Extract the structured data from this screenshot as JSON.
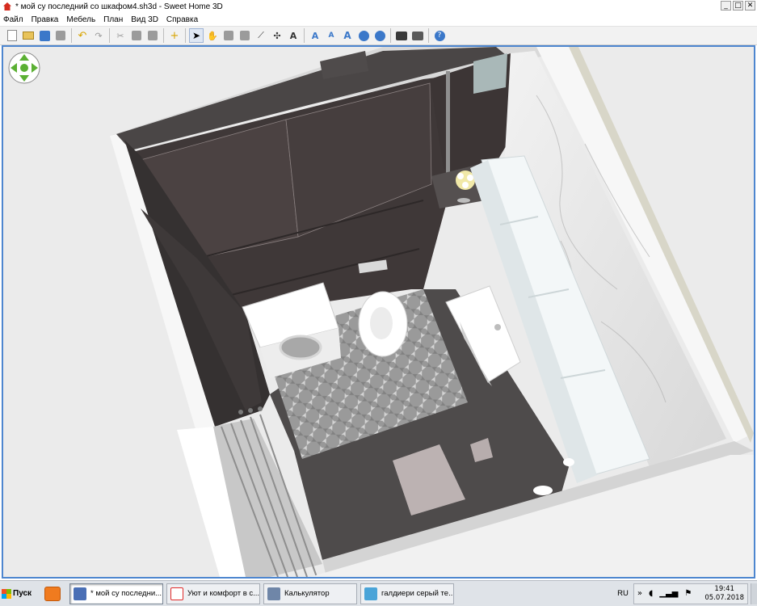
{
  "window": {
    "title": "* мой су последний со шкафом4.sh3d - Sweet Home 3D",
    "buttons": {
      "minimize": "_",
      "maximize": "□",
      "close": "✕"
    }
  },
  "menu": {
    "items": [
      "Файл",
      "Правка",
      "Мебель",
      "План",
      "Вид 3D",
      "Справка"
    ]
  },
  "toolbar": {
    "buttons": [
      {
        "name": "new-home",
        "icon": "document-icon"
      },
      {
        "name": "open",
        "icon": "folder-icon"
      },
      {
        "name": "save",
        "icon": "save-icon"
      },
      {
        "name": "preferences",
        "icon": "tools-icon"
      },
      {
        "name": "undo",
        "icon": "undo-icon"
      },
      {
        "name": "redo",
        "icon": "redo-icon"
      },
      {
        "name": "cut",
        "icon": "cut-icon"
      },
      {
        "name": "copy",
        "icon": "copy-icon"
      },
      {
        "name": "paste",
        "icon": "paste-icon"
      },
      {
        "name": "add-furniture",
        "icon": "add-furniture-icon"
      },
      {
        "name": "select-mode",
        "icon": "pointer-icon"
      },
      {
        "name": "pan-mode",
        "icon": "hand-icon"
      },
      {
        "name": "create-walls",
        "icon": "walls-icon"
      },
      {
        "name": "create-rooms",
        "icon": "rooms-icon"
      },
      {
        "name": "create-polylines",
        "icon": "polyline-icon"
      },
      {
        "name": "create-dimensions",
        "icon": "dimension-icon"
      },
      {
        "name": "add-text",
        "icon": "text-icon"
      },
      {
        "name": "increase-text",
        "icon": "text-larger-icon"
      },
      {
        "name": "decrease-text",
        "icon": "text-smaller-icon"
      },
      {
        "name": "bold-text",
        "icon": "bold-text-icon"
      },
      {
        "name": "zoom-in",
        "icon": "zoom-in-icon"
      },
      {
        "name": "zoom-out",
        "icon": "zoom-out-icon"
      },
      {
        "name": "create-photo",
        "icon": "camera-icon"
      },
      {
        "name": "create-video",
        "icon": "video-icon"
      },
      {
        "name": "help",
        "icon": "help-icon"
      }
    ],
    "glyphs": {
      "add": "+",
      "text": "A",
      "help": "?"
    }
  },
  "taskbar": {
    "start_label": "Пуск",
    "tasks": [
      {
        "label": "* мой су последни...",
        "icon_color": "#4a6fb5",
        "active": true
      },
      {
        "label": "Уют и комфорт в с...",
        "icon_color": "#e02a2a",
        "active": false
      },
      {
        "label": "Калькулятор",
        "icon_color": "#6f86a8",
        "active": false
      },
      {
        "label": "галдиери серый те...",
        "icon_color": "#4aa4d8",
        "active": false
      }
    ],
    "tray": {
      "language": "RU",
      "time": "19:41",
      "date": "05.07.2018"
    }
  },
  "colors": {
    "view_border": "#4d86cf",
    "dark_wall": "#3d3838",
    "floor_tile": "#8c8c8c",
    "marble": "#e6e6e6"
  }
}
